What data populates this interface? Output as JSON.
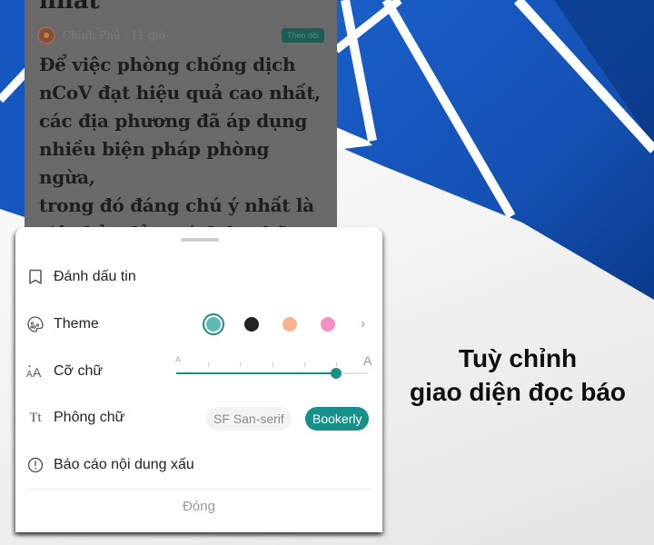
{
  "background": {
    "accent_blue": "#1753b8",
    "dark_blue": "#0b3a8c"
  },
  "article": {
    "title_tail": "nhất",
    "source": "Chính Phủ · 11 giờ",
    "follow_label": "Theo dõi",
    "body_lines": [
      "Để việc phòng chống dịch",
      "nCoV đạt hiệu quả cao nhất,",
      "các địa phương đã áp dụng",
      "nhiều biện pháp phòng ngừa,",
      "trong đó đáng chú ý nhất là",
      "việc bảo đảm cách ly những"
    ]
  },
  "sheet": {
    "items": [
      {
        "id": "bookmark",
        "icon": "bookmark-icon",
        "label": "Đánh dấu tin"
      },
      {
        "id": "theme",
        "icon": "palette-icon",
        "label": "Theme"
      },
      {
        "id": "font-size",
        "icon": "font-size-icon",
        "label": "Cỡ chữ"
      },
      {
        "id": "font",
        "icon": "font-family-icon",
        "icon_text": "Tt",
        "label": "Phông chữ"
      },
      {
        "id": "report",
        "icon": "alert-circle-icon",
        "label": "Báo cáo nội dung xấu"
      }
    ],
    "theme": {
      "swatches": [
        {
          "name": "teal",
          "color": "#5cbcb2",
          "selected": true
        },
        {
          "name": "black",
          "color": "#222222",
          "selected": false
        },
        {
          "name": "peach",
          "color": "#f9b48e",
          "selected": false
        },
        {
          "name": "pink",
          "color": "#f68fc3",
          "selected": false
        }
      ],
      "more_icon": "chevron-right-icon"
    },
    "font_size": {
      "min_label": "A",
      "max_label": "A",
      "steps": 6,
      "value_step": 5
    },
    "font_family": {
      "options": [
        "SF San-serif",
        "Bookerly"
      ],
      "selected": "Bookerly"
    },
    "close_label": "Đóng"
  },
  "caption": {
    "line1": "Tuỳ chỉnh",
    "line2": "giao diện đọc báo"
  }
}
